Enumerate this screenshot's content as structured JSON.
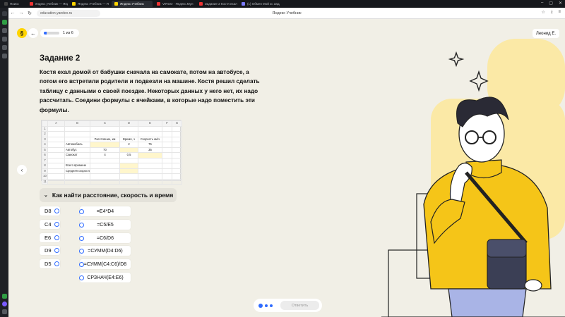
{
  "browser": {
    "tabs": [
      {
        "label": "Поиск",
        "color": "#444"
      },
      {
        "label": "яндекс учебник — Янде",
        "color": "#e33"
      },
      {
        "label": "Яндекс Учебник — Я",
        "color": "#ffd400"
      },
      {
        "label": "Яндекс Учебник",
        "color": "#ffd400"
      },
      {
        "label": "VIRGO · Яндекс.Мул",
        "color": "#e33"
      },
      {
        "label": "Задание 2 Костя ехал до",
        "color": "#e33"
      },
      {
        "label": "(1) Обмен Мой кс Задан",
        "color": "#7b7bff"
      }
    ],
    "active_tab_index": 3,
    "url": "education.yandex.ru",
    "page_title": "Яндекс Учебник"
  },
  "header": {
    "logo": "§",
    "back_icon": "←",
    "progress_text": "1 из 6",
    "progress_fraction": 0.17,
    "user": "Леонид Е."
  },
  "task": {
    "title": "Задание 2",
    "text": "Костя ехал домой от бабушки сначала на самокате, потом на автобусе, а потом его встретили родители и подвезли на машине. Костя решил сделать таблицу с данными о своей поездке. Некоторых данных у него нет, их надо рассчитать. Соедини формулы с ячейками, в которые надо поместить эти формулы."
  },
  "sheet": {
    "columns": [
      "",
      "A",
      "B",
      "C",
      "D",
      "E",
      "F",
      "G"
    ],
    "rows": [
      [
        "1",
        "",
        "",
        "",
        "",
        "",
        "",
        ""
      ],
      [
        "2",
        "",
        "",
        "",
        "",
        "",
        "",
        ""
      ],
      [
        "3",
        "",
        "",
        "Расстояние, км",
        "Время, ч",
        "Скорость км/ч",
        "",
        ""
      ],
      [
        "4",
        "",
        "Автомобиль",
        "",
        "2",
        "75",
        "",
        ""
      ],
      [
        "5",
        "",
        "Автобус",
        "70",
        "",
        "35",
        "",
        ""
      ],
      [
        "6",
        "",
        "Самокат",
        "4",
        "0,5",
        "",
        "",
        ""
      ],
      [
        "7",
        "",
        "",
        "",
        "",
        "",
        "",
        ""
      ],
      [
        "8",
        "",
        "Всего времени",
        "",
        "",
        "",
        "",
        ""
      ],
      [
        "9",
        "",
        "Средняя скорость",
        "",
        "",
        "",
        "",
        ""
      ],
      [
        "10",
        "",
        "",
        "",
        "",
        "",
        "",
        ""
      ],
      [
        "11",
        "",
        "",
        "",
        "",
        "",
        "",
        ""
      ]
    ]
  },
  "accordion": {
    "label": "Как найти расстояние, скорость и время"
  },
  "cells": [
    "D8",
    "C4",
    "E6",
    "D9",
    "D5"
  ],
  "formulas": [
    "=E4*D4",
    "=C5/E5",
    "=C6/D6",
    "=СУММ(D4:D6)",
    "=СУММ(C4:C6)/D8",
    "СРЗНАЧ(E4:E6)"
  ],
  "bottom": {
    "answer_label": "Ответить",
    "pages": 3,
    "current_page": 1
  },
  "colors": {
    "accent": "#2f6bff",
    "brand_yellow": "#ffd400",
    "background": "#f1efe6"
  }
}
